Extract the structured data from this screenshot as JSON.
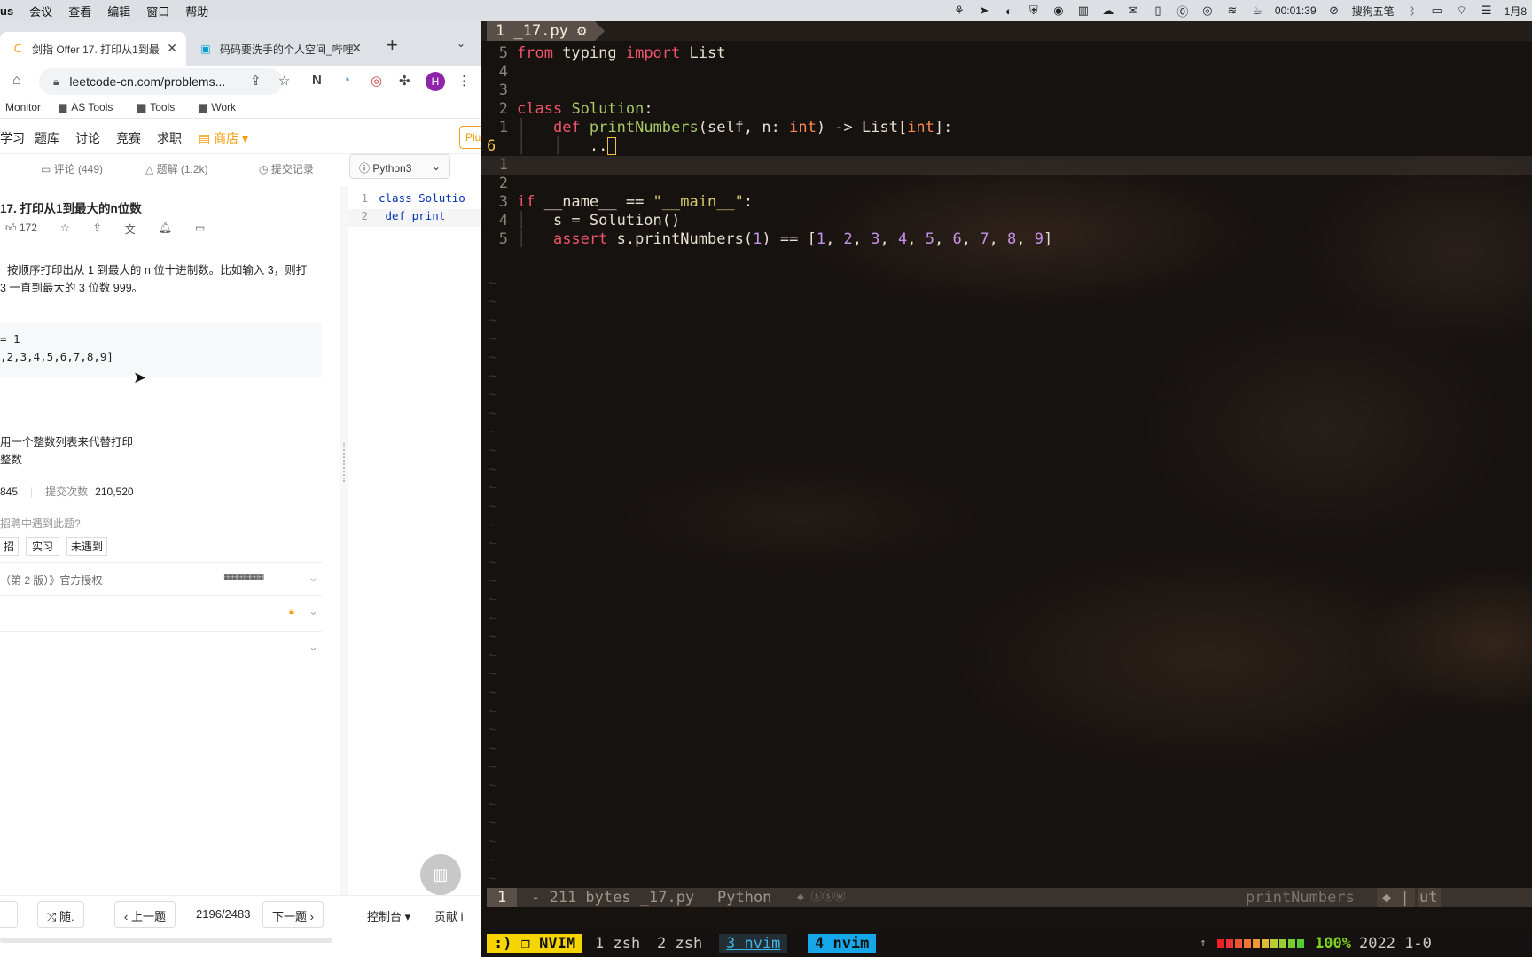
{
  "menubar": {
    "app": "us",
    "items": [
      "会议",
      "查看",
      "编辑",
      "窗口",
      "帮助"
    ],
    "timer": "00:01:39",
    "ime": "搜狗五笔",
    "date": "1月8"
  },
  "browser": {
    "tabs": [
      {
        "title": "剑指 Offer 17. 打印从1到最",
        "active": true
      },
      {
        "title": "码码要洗手的个人空间_哔哩",
        "active": false
      }
    ],
    "url": "leetcode-cn.com/problems...",
    "avatar": "H",
    "bookmarks": [
      "Monitor",
      "AS Tools",
      "Tools",
      "Work"
    ]
  },
  "leetcode": {
    "nav": [
      "学习",
      "题库",
      "讨论",
      "竞赛",
      "求职",
      "商店"
    ],
    "plus": "Plu",
    "subtabs": {
      "comments": "评论 (449)",
      "solutions": "题解 (1.2k)",
      "submissions": "提交记录",
      "lang": "Python3"
    },
    "title": "17. 打印从1到最大的n位数",
    "likes": "172",
    "desc_line1": "按顺序打印出从 1 到最大的 n 位十进制数。比如输入 3，则打",
    "desc_line2": "3 一直到最大的 3 位数 999。",
    "example_line1": "= 1",
    "example_line2": ",2,3,4,5,6,7,8,9]",
    "note_line1": "用一个整数列表来代替打印",
    "note_line2": "整数",
    "accepted": "845",
    "submissions_label": "提交次数",
    "submissions": "210,520",
    "interview_q": "招聘中遇到此题?",
    "tags": [
      "招",
      "实习",
      "未遇到"
    ],
    "license": "（第 2 版）》官方授权",
    "code": [
      {
        "n": "1",
        "text": "class Solutio"
      },
      {
        "n": "2",
        "text": "    def print"
      }
    ],
    "bottom": {
      "random": "随.",
      "prev": "上一题",
      "page": "2196/2483",
      "next": "下一题",
      "console": "控制台",
      "contribute": "贡献 i"
    }
  },
  "vim": {
    "tab": "1  _17.py",
    "lines": [
      {
        "ln": "5",
        "tokens": [
          [
            "k",
            "from"
          ],
          [
            "bi",
            " typing "
          ],
          [
            "k",
            "import"
          ],
          [
            "bi",
            " List"
          ]
        ]
      },
      {
        "ln": "4",
        "tokens": []
      },
      {
        "ln": "3",
        "tokens": []
      },
      {
        "ln": "2",
        "tokens": [
          [
            "k",
            "class"
          ],
          [
            "bi",
            " "
          ],
          [
            "f",
            "Solution"
          ],
          [
            "bi",
            ":"
          ]
        ]
      },
      {
        "ln": "1",
        "tokens": [
          [
            "pip",
            "│   "
          ],
          [
            "k",
            "def"
          ],
          [
            "bi",
            " "
          ],
          [
            "f",
            "printNumbers"
          ],
          [
            "bi",
            "(self, n: "
          ],
          [
            "ty",
            "int"
          ],
          [
            "bi",
            ") -> List["
          ],
          [
            "ty",
            "int"
          ],
          [
            "bi",
            "]:"
          ]
        ]
      },
      {
        "ln": "6",
        "tokens": [
          [
            "pip",
            "│   │   "
          ],
          [
            "bi",
            ".."
          ]
        ],
        "current": true
      },
      {
        "ln": "1",
        "tokens": []
      },
      {
        "ln": "2",
        "tokens": []
      },
      {
        "ln": "3",
        "tokens": [
          [
            "k",
            "if"
          ],
          [
            "bi",
            " __name__ == "
          ],
          [
            "s",
            "\"__main__\""
          ],
          [
            "bi",
            ":"
          ]
        ]
      },
      {
        "ln": "4",
        "tokens": [
          [
            "pip",
            "│   "
          ],
          [
            "bi",
            "s = Solution()"
          ]
        ]
      },
      {
        "ln": "5",
        "tokens": [
          [
            "pip",
            "│   "
          ],
          [
            "k",
            "assert"
          ],
          [
            "bi",
            " s.printNumbers("
          ],
          [
            "num",
            "1"
          ],
          [
            "bi",
            ") == ["
          ],
          [
            "num",
            "1"
          ],
          [
            "bi",
            ", "
          ],
          [
            "num",
            "2"
          ],
          [
            "bi",
            ", "
          ],
          [
            "num",
            "3"
          ],
          [
            "bi",
            ", "
          ],
          [
            "num",
            "4"
          ],
          [
            "bi",
            ", "
          ],
          [
            "num",
            "5"
          ],
          [
            "bi",
            ", "
          ],
          [
            "num",
            "6"
          ],
          [
            "bi",
            ", "
          ],
          [
            "num",
            "7"
          ],
          [
            "bi",
            ", "
          ],
          [
            "num",
            "8"
          ],
          [
            "bi",
            ", "
          ],
          [
            "num",
            "9"
          ],
          [
            "bi",
            "]"
          ]
        ]
      }
    ],
    "status": {
      "mode": "1",
      "file": "- 211 bytes _17.py",
      "ft": "Python",
      "flags": "◆ ⓢⓢⓦ",
      "func": "printNumbers",
      "right": "ut"
    }
  },
  "tmux": {
    "mode": ":) ❐ NVIM",
    "windows": [
      "1 zsh",
      "2 zsh",
      "3 nvim",
      "4 nvim"
    ],
    "battery": "100%",
    "date": "2022 1-0"
  }
}
